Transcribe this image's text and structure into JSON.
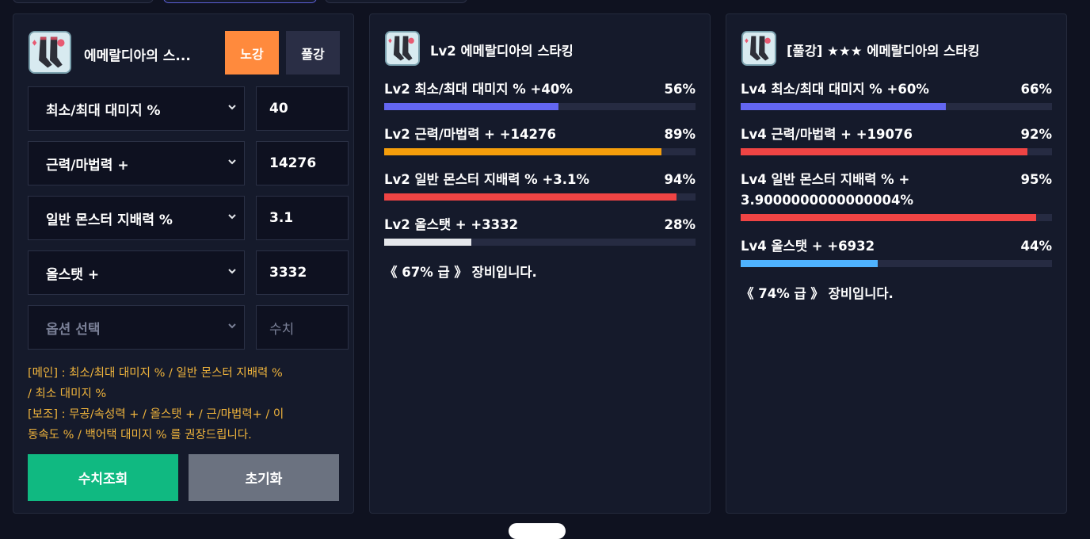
{
  "input_panel": {
    "item_name": "에메랄디아의 스...",
    "grade_buttons": [
      "노강",
      "풀강"
    ],
    "options": [
      {
        "option": "최소/최대 대미지 %",
        "value": "40"
      },
      {
        "option": "근력/마법력 +",
        "value": "14276"
      },
      {
        "option": "일반 몬스터 지배력 %",
        "value": "3.1"
      },
      {
        "option": "올스탯 +",
        "value": "3332"
      }
    ],
    "empty_option_placeholder": "옵션 선택",
    "empty_value_placeholder": "수치",
    "note_lines": [
      "[메인] : 최소/최대 대미지 % / 일반 몬스터 지배력 %",
      "/ 최소 대미지 %",
      "[보조] : 무공/속성력 + / 올스탯 + / 근/마법력+ / 이",
      "동속도 % / 백어택 대미지 % 를 권장드립니다."
    ],
    "lookup_button": "수치조회",
    "reset_button": "초기화",
    "colors": {
      "lookup": "#10b981",
      "reset": "#6b7280",
      "active_grade": "#ff8a3d",
      "grade": "#2a2e45",
      "note": "#f0b43c"
    }
  },
  "result_left": {
    "title": "Lv2 에메랄디아의 스타킹",
    "stats": [
      {
        "label": "Lv2 최소/최대 대미지 % +40%",
        "percent": 56,
        "pct_text": "56%",
        "color": "#6366f1"
      },
      {
        "label": "Lv2 근력/마법력 + +14276",
        "percent": 89,
        "pct_text": "89%",
        "color": "#f59e0b"
      },
      {
        "label": "Lv2 일반 몬스터 지배력 % +3.1%",
        "percent": 94,
        "pct_text": "94%",
        "color": "#ef4444"
      },
      {
        "label": "Lv2 올스탯 + +3332",
        "percent": 28,
        "pct_text": "28%",
        "color": "#e5e7eb"
      }
    ],
    "summary": "《 67% 급 》 장비입니다."
  },
  "result_right": {
    "title": "[풀강] ★★★ 에메랄디아의 스타킹",
    "stats": [
      {
        "label": "Lv4 최소/최대 대미지 % +60%",
        "percent": 66,
        "pct_text": "66%",
        "color": "#6366f1"
      },
      {
        "label": "Lv4 근력/마법력 + +19076",
        "percent": 92,
        "pct_text": "92%",
        "color": "#ef4444"
      },
      {
        "label": "Lv4 일반 몬스터 지배력 % +3.9000000000000004%",
        "percent": 95,
        "pct_text": "95%",
        "color": "#ef4444"
      },
      {
        "label": "Lv4 올스탯 + +6932",
        "percent": 44,
        "pct_text": "44%",
        "color": "#4fb3ff"
      }
    ],
    "summary": "《 74% 급 》 장비입니다."
  }
}
